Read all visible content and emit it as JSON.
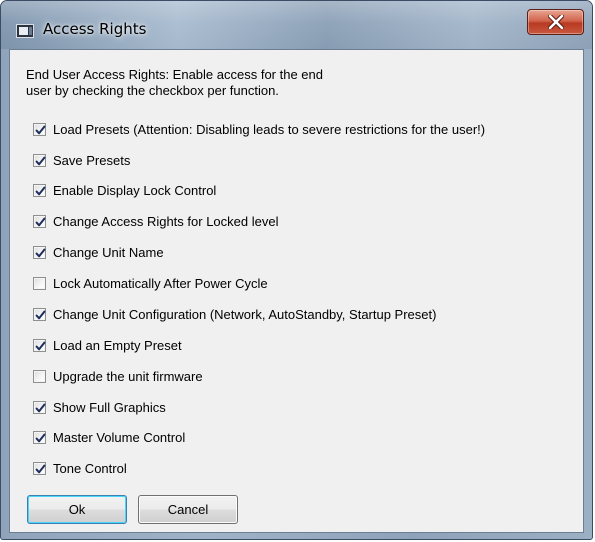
{
  "window": {
    "title": "Access Rights",
    "icon": "app-window-icon",
    "close_icon": "close-icon"
  },
  "description": "End User Access Rights: Enable access for the end\nuser by checking the checkbox per function.",
  "options": [
    {
      "label": "Load Presets (Attention: Disabling leads to severe restrictions for the user!)",
      "checked": true
    },
    {
      "label": "Save Presets",
      "checked": true
    },
    {
      "label": "Enable Display Lock Control",
      "checked": true
    },
    {
      "label": "Change Access Rights for Locked level",
      "checked": true
    },
    {
      "label": "Change Unit Name",
      "checked": true
    },
    {
      "label": "Lock Automatically After Power Cycle",
      "checked": false
    },
    {
      "label": "Change Unit Configuration (Network, AutoStandby, Startup Preset)",
      "checked": true
    },
    {
      "label": "Load an Empty Preset",
      "checked": true
    },
    {
      "label": "Upgrade the unit firmware",
      "checked": false
    },
    {
      "label": "Show Full Graphics",
      "checked": true
    },
    {
      "label": "Master Volume Control",
      "checked": true
    },
    {
      "label": "Tone Control",
      "checked": true
    }
  ],
  "buttons": {
    "ok_label": "Ok",
    "cancel_label": "Cancel"
  },
  "colors": {
    "checkmark": "#1d2d5c",
    "close_button": "#c9583f"
  }
}
